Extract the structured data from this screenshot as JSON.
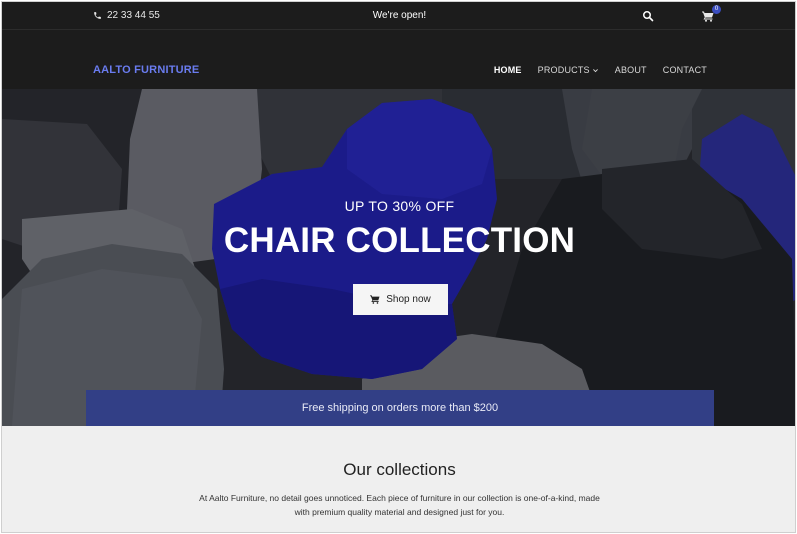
{
  "topbar": {
    "phone_icon": "phone-icon",
    "phone": "22 33 44 55",
    "status": "We're open!",
    "search_icon": "search-icon",
    "cart_icon": "cart-icon",
    "cart_count": "0"
  },
  "nav": {
    "brand": "AALTO FURNITURE",
    "items": [
      {
        "label": "HOME",
        "active": true
      },
      {
        "label": "PRODUCTS",
        "dropdown": true
      },
      {
        "label": "ABOUT"
      },
      {
        "label": "CONTACT"
      }
    ]
  },
  "hero": {
    "subtitle": "UP TO 30% OFF",
    "title": "CHAIR COLLECTION",
    "button_label": "Shop now",
    "button_icon": "cart-icon",
    "shipping": "Free shipping on orders more than $200"
  },
  "collections": {
    "title": "Our collections",
    "text": "At Aalto Furniture, no detail goes unnoticed. Each piece of furniture in our collection is one-of-a-kind, made with premium quality material and designed just for you."
  },
  "colors": {
    "brand": "#6a7cf0",
    "header_bg": "#1c1c1c",
    "shipping_bar": "#323f86",
    "chair_blue": "#2222a8"
  }
}
